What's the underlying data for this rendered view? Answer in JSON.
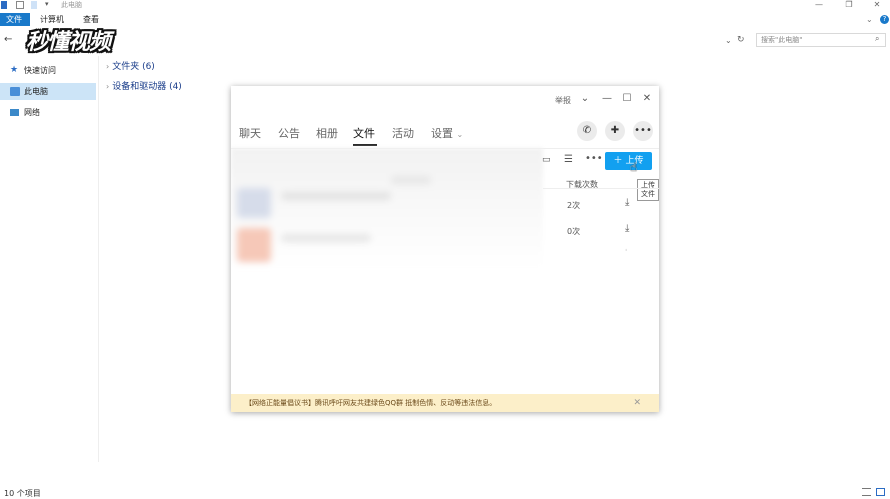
{
  "window_title": "此电脑",
  "ribbon": {
    "tabs": [
      "文件",
      "计算机",
      "查看"
    ]
  },
  "address": {
    "search_placeholder": "搜索\"此电脑\""
  },
  "sidebar": {
    "items": [
      {
        "label": "快速访问",
        "icon": "pin-star-icon"
      },
      {
        "label": "此电脑",
        "icon": "computer-icon",
        "selected": true
      },
      {
        "label": "网络",
        "icon": "network-icon"
      }
    ]
  },
  "content": {
    "groups": [
      {
        "label": "文件夹 (6)"
      },
      {
        "label": "设备和驱动器 (4)"
      }
    ]
  },
  "status": {
    "item_count": "10 个项目"
  },
  "watermark": "秒懂视频",
  "qq": {
    "report": "举报",
    "tabs": [
      "聊天",
      "公告",
      "相册",
      "文件",
      "活动",
      "设置"
    ],
    "active_tab": "文件",
    "upload_label": "上传",
    "tooltip": "上传文件",
    "column_downloads": "下载次数",
    "rows": [
      {
        "downloads": "2次"
      },
      {
        "downloads": "0次"
      }
    ],
    "notice": "【网络正能量倡议书】腾讯呼吁网友共建绿色QQ群 抵制色情、反动等违法信息。",
    "accent": "#12a0f0",
    "notice_bg": "#fcefc9"
  }
}
